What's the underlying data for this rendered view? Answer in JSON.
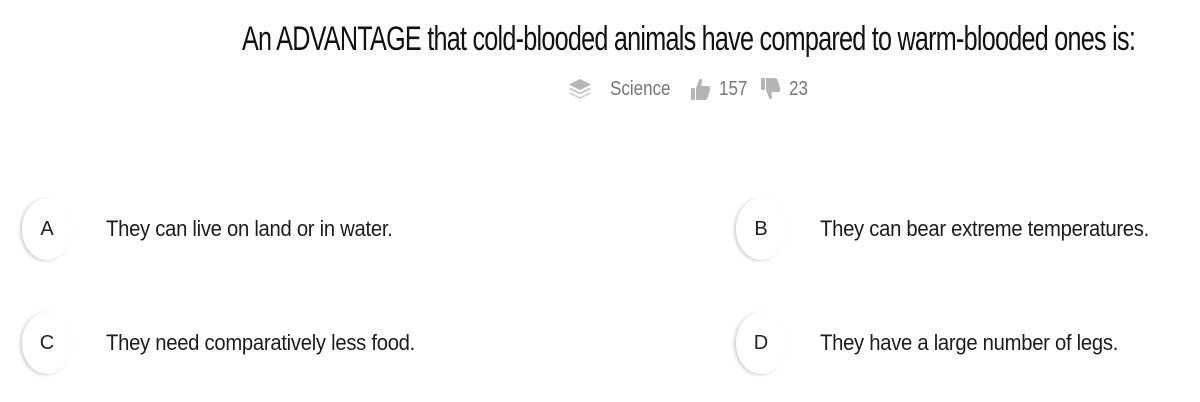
{
  "question": {
    "text": "An ADVANTAGE that cold-blooded animals have compared to warm-blooded ones is:"
  },
  "meta": {
    "subject": "Science",
    "subject_icon": "layers-icon",
    "likes": "157",
    "likes_icon": "thumbs-up-icon",
    "dislikes": "23",
    "dislikes_icon": "thumbs-down-icon"
  },
  "options": [
    {
      "letter": "A",
      "text": "They can live on land or in water."
    },
    {
      "letter": "B",
      "text": "They can bear extreme temperatures."
    },
    {
      "letter": "C",
      "text": "They need comparatively less food."
    },
    {
      "letter": "D",
      "text": "They have a large number of legs."
    }
  ],
  "colors": {
    "meta_gray": "#777777",
    "icon_gray": "#b5b5b5",
    "text": "#1c1c1c"
  }
}
